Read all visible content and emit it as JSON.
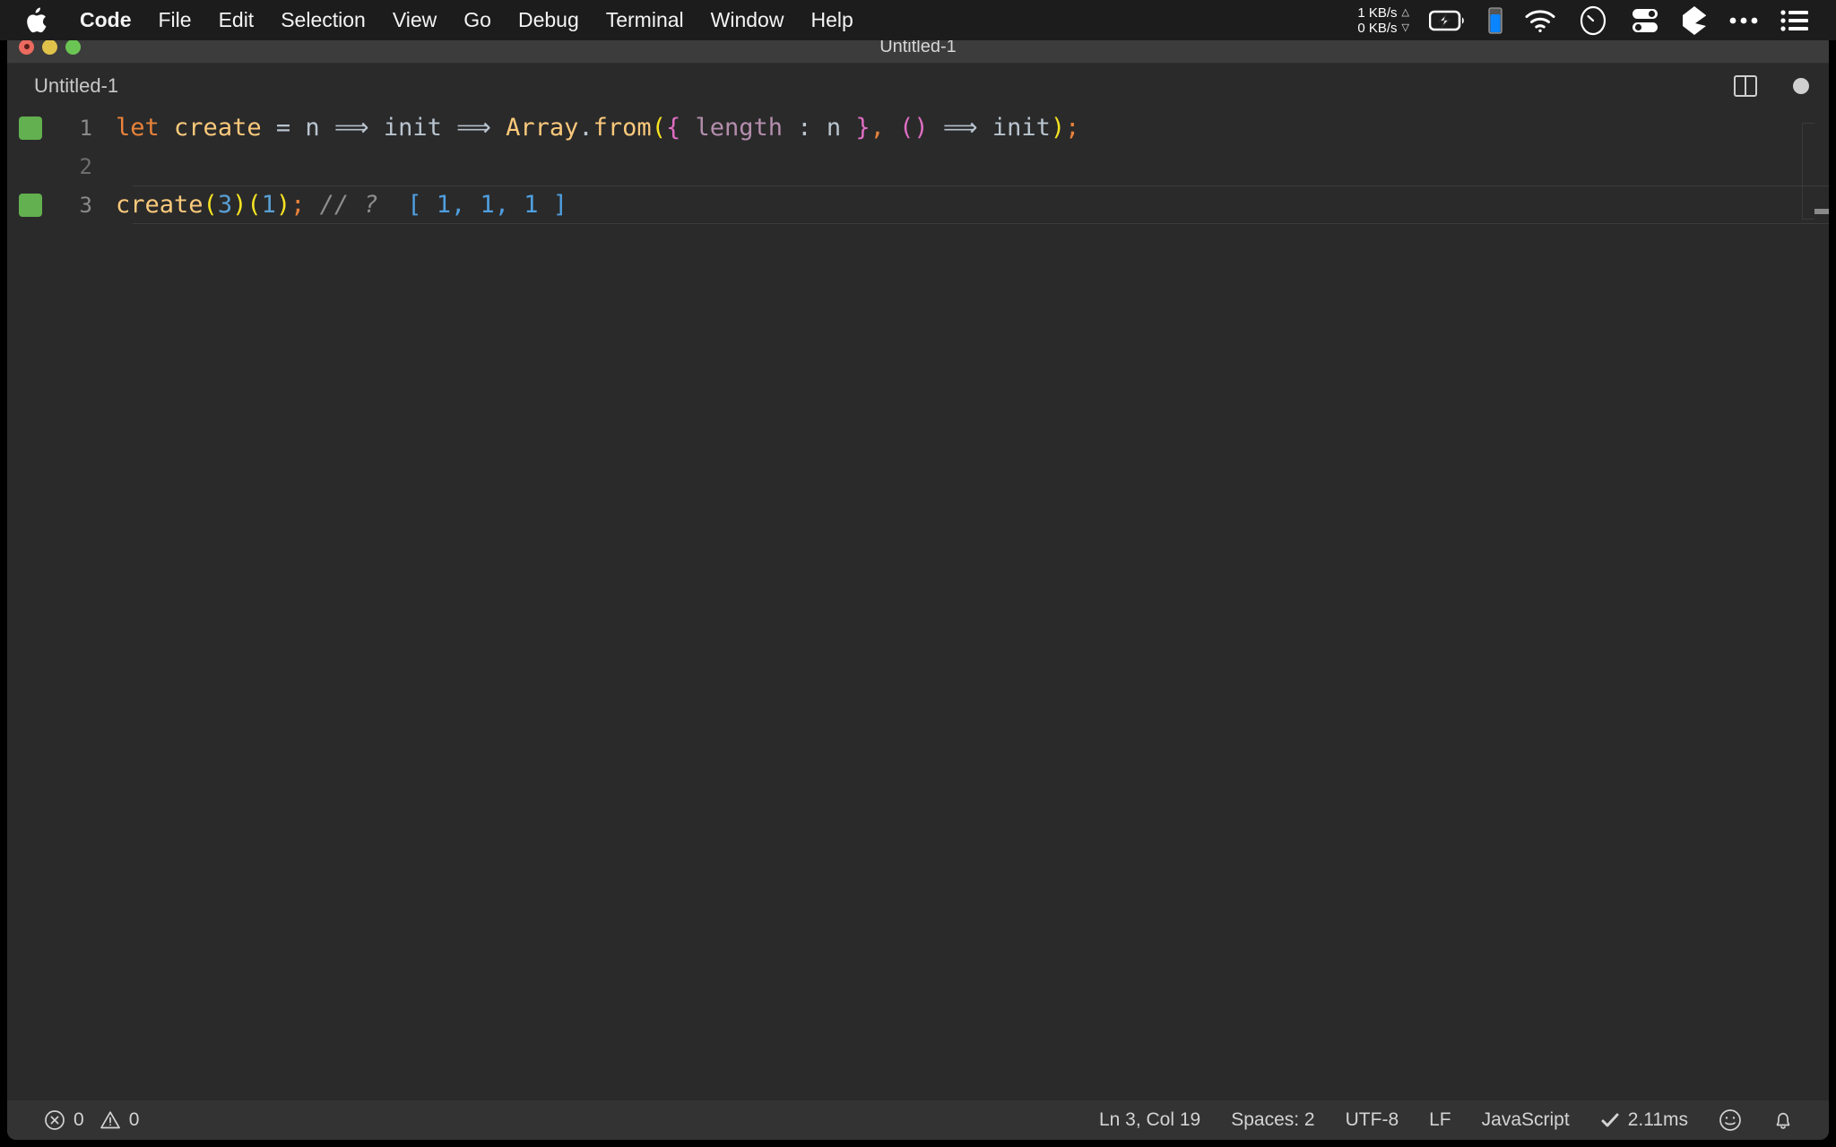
{
  "menubar": {
    "apple_icon": "apple-logo-icon",
    "items": [
      {
        "label": "Code",
        "bold": true
      },
      {
        "label": "File",
        "bold": false
      },
      {
        "label": "Edit",
        "bold": false
      },
      {
        "label": "Selection",
        "bold": false
      },
      {
        "label": "View",
        "bold": false
      },
      {
        "label": "Go",
        "bold": false
      },
      {
        "label": "Debug",
        "bold": false
      },
      {
        "label": "Terminal",
        "bold": false
      },
      {
        "label": "Window",
        "bold": false
      },
      {
        "label": "Help",
        "bold": false
      }
    ],
    "tray": {
      "upload_speed": "1 KB/s",
      "download_speed": "0 KB/s",
      "up_arrow": "△",
      "down_arrow": "▽",
      "icons": [
        "battery-charging-icon",
        "blue-bar-indicator-icon",
        "wifi-icon",
        "clock-gauge-icon",
        "toggle-switches-icon",
        "pen-marker-icon",
        "ellipsis-icon",
        "list-menu-icon"
      ],
      "battery_accent": "#ffffff",
      "blue_indicator_color": "#0a84ff"
    }
  },
  "window": {
    "title": "Untitled-1",
    "traffic_lights": [
      "close",
      "minimize",
      "zoom"
    ],
    "colors": {
      "close": "#ec6a5f",
      "minimize": "#e0c24b",
      "zoom": "#6bc554",
      "titlebar_bg": "#3c3c3c",
      "editor_bg": "#2a2a2a",
      "statusbar_bg": "#333333"
    }
  },
  "tabbar": {
    "tab_label": "Untitled-1",
    "split_editor_icon": "split-editor-icon",
    "dirty_indicator": "unsaved-dot-icon"
  },
  "editor": {
    "language": "JavaScript",
    "lines": [
      {
        "number": "1",
        "coverage": "covered",
        "active": false,
        "tokens": [
          {
            "text": "let",
            "cls": "t-key"
          },
          {
            "text": " ",
            "cls": "t-plain"
          },
          {
            "text": "create",
            "cls": "t-fn"
          },
          {
            "text": " = ",
            "cls": "t-plain"
          },
          {
            "text": "n",
            "cls": "t-plain"
          },
          {
            "text": " ⟹ ",
            "cls": "t-plain"
          },
          {
            "text": "init",
            "cls": "t-plain"
          },
          {
            "text": " ⟹ ",
            "cls": "t-plain"
          },
          {
            "text": "Array",
            "cls": "t-fn"
          },
          {
            "text": ".",
            "cls": "t-plain"
          },
          {
            "text": "from",
            "cls": "t-fn"
          },
          {
            "text": "(",
            "cls": "t-yellow"
          },
          {
            "text": "{",
            "cls": "t-magenta"
          },
          {
            "text": " ",
            "cls": "t-plain"
          },
          {
            "text": "length",
            "cls": "t-purple"
          },
          {
            "text": " : ",
            "cls": "t-plain"
          },
          {
            "text": "n",
            "cls": "t-plain"
          },
          {
            "text": " ",
            "cls": "t-plain"
          },
          {
            "text": "}",
            "cls": "t-magenta"
          },
          {
            "text": ",",
            "cls": "t-orange"
          },
          {
            "text": " ",
            "cls": "t-plain"
          },
          {
            "text": "()",
            "cls": "t-magenta"
          },
          {
            "text": " ⟹ ",
            "cls": "t-plain"
          },
          {
            "text": "init",
            "cls": "t-plain"
          },
          {
            "text": ")",
            "cls": "t-yellow"
          },
          {
            "text": ";",
            "cls": "t-orange"
          }
        ]
      },
      {
        "number": "2",
        "coverage": "blank",
        "active": false,
        "tokens": []
      },
      {
        "number": "3",
        "coverage": "covered",
        "active": true,
        "tokens": [
          {
            "text": "create",
            "cls": "t-fn"
          },
          {
            "text": "(",
            "cls": "t-yellow"
          },
          {
            "text": "3",
            "cls": "t-num"
          },
          {
            "text": ")",
            "cls": "t-yellow"
          },
          {
            "text": "(",
            "cls": "t-yellow"
          },
          {
            "text": "1",
            "cls": "t-num"
          },
          {
            "text": ")",
            "cls": "t-yellow"
          },
          {
            "text": ";",
            "cls": "t-orange"
          },
          {
            "text": " ",
            "cls": "t-plain"
          },
          {
            "text": "// ?",
            "cls": "t-comment"
          },
          {
            "text": "  ",
            "cls": "t-plain"
          },
          {
            "text": "[ 1, 1, 1 ]",
            "cls": "t-result"
          }
        ]
      }
    ],
    "coverage_color": "#62b04f"
  },
  "statusbar": {
    "errors_icon": "error-circle-icon",
    "errors_count": "0",
    "warnings_icon": "warning-triangle-icon",
    "warnings_count": "0",
    "cursor_position": "Ln 3, Col 19",
    "indentation": "Spaces: 2",
    "encoding": "UTF-8",
    "eol": "LF",
    "language_mode": "JavaScript",
    "run_check_icon": "checkmark-icon",
    "run_time": "2.11ms",
    "feedback_icon": "smiley-icon",
    "notifications_icon": "bell-icon"
  }
}
